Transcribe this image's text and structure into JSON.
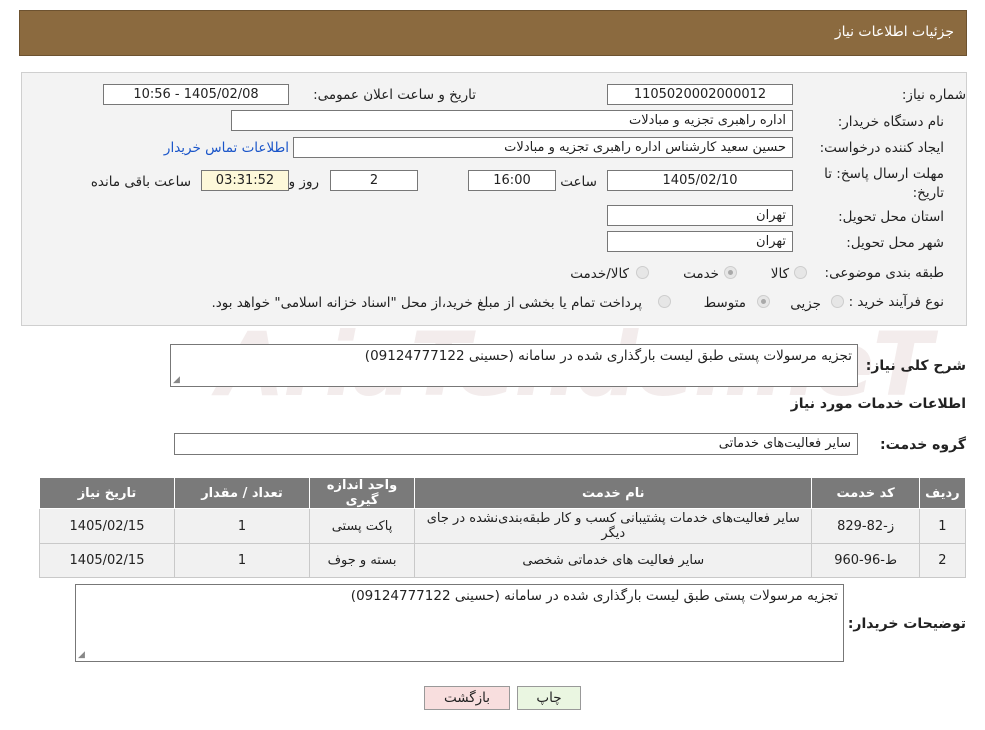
{
  "header": {
    "title": "جزئیات اطلاعات نیاز"
  },
  "fields": {
    "need_number_label": "شماره نیاز:",
    "need_number": "1105020002000012",
    "announce_label": "تاریخ و ساعت اعلان عمومی:",
    "announce_value": "1405/02/08 - 10:56",
    "buyer_org_label": "نام دستگاه خریدار:",
    "buyer_org": "اداره راهبری تجزیه و مبادلات",
    "creator_label": "ایجاد کننده درخواست:",
    "creator": "حسین سعید کارشناس اداره راهبری تجزیه و مبادلات",
    "contact_link": "اطلاعات تماس خریدار",
    "deadline_label": "مهلت ارسال پاسخ: تا تاریخ:",
    "deadline_date": "1405/02/10",
    "time_label": "ساعت",
    "deadline_time": "16:00",
    "days_value": "2",
    "days_label": "روز و",
    "remaining_time": "03:31:52",
    "remaining_label": "ساعت باقی مانده",
    "province_label": "استان محل تحویل:",
    "province": "تهران",
    "city_label": "شهر محل تحویل:",
    "city": "تهران",
    "category_label": "طبقه بندی موضوعی:",
    "cat_goods": "کالا",
    "cat_service": "خدمت",
    "cat_both": "کالا/خدمت",
    "process_label": "نوع فرآیند خرید :",
    "proc_partial": "جزیی",
    "proc_medium": "متوسط",
    "proc_note": "پرداخت تمام یا بخشی از مبلغ خرید،از محل \"اسناد خزانه اسلامی\" خواهد بود."
  },
  "summary": {
    "label": "شرح کلی نیاز:",
    "value": "تجزیه مرسولات پستی طبق لیست بارگذاری شده در سامانه (حسینی 09124777122)"
  },
  "services": {
    "section_title": "اطلاعات خدمات مورد نیاز",
    "group_label": "گروه خدمت:",
    "group_value": "سایر فعالیت‌های خدماتی",
    "columns": [
      "ردیف",
      "کد خدمت",
      "نام خدمت",
      "واحد اندازه گیری",
      "تعداد / مقدار",
      "تاریخ نیاز"
    ],
    "rows": [
      [
        "1",
        "ز-82-829",
        "سایر فعالیت‌های خدمات پشتیبانی کسب و کار طبقه‌بندی‌نشده در جای دیگر",
        "پاکت پستی",
        "1",
        "1405/02/15"
      ],
      [
        "2",
        "ط-96-960",
        "سایر فعالیت های خدماتی شخصی",
        "بسته و جوف",
        "1",
        "1405/02/15"
      ]
    ]
  },
  "buyer_notes": {
    "label": "توضیحات خریدار:",
    "value": "تجزیه مرسولات پستی طبق لیست بارگذاری شده در سامانه (حسینی 09124777122)"
  },
  "buttons": {
    "print": "چاپ",
    "back": "بازگشت"
  },
  "watermark": "AriaTender.neT",
  "colors": {
    "header": "#8b6a3f",
    "table_header": "#7a7a7a",
    "link": "#1a55c9",
    "print_btn": "#eaf6e1",
    "back_btn": "#f8dede"
  }
}
